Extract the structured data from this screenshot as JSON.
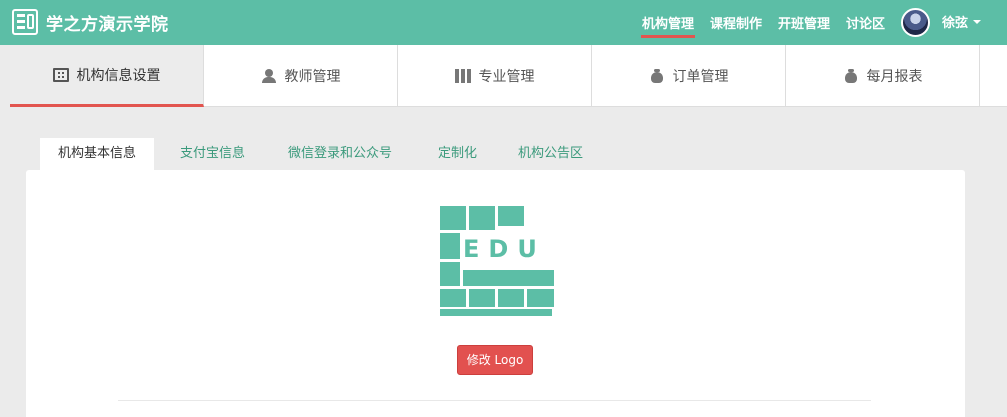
{
  "brand": {
    "title": "学之方演示学院",
    "logo_text": "EDU"
  },
  "topnav": {
    "links": [
      {
        "label": "机构管理",
        "active": true
      },
      {
        "label": "课程制作",
        "active": false
      },
      {
        "label": "开班管理",
        "active": false
      },
      {
        "label": "讨论区",
        "active": false
      }
    ],
    "user_name": "徐弦"
  },
  "subnav": {
    "tabs": [
      {
        "label": "机构信息设置",
        "icon": "building-icon",
        "active": true
      },
      {
        "label": "教师管理",
        "icon": "user-icon",
        "active": false
      },
      {
        "label": "专业管理",
        "icon": "book-icon",
        "active": false
      },
      {
        "label": "订单管理",
        "icon": "money-bag-icon",
        "active": false
      },
      {
        "label": "每月报表",
        "icon": "money-bag-icon",
        "active": false
      }
    ]
  },
  "content_tabs": [
    {
      "label": "机构基本信息",
      "active": true
    },
    {
      "label": "支付宝信息",
      "active": false
    },
    {
      "label": "微信登录和公众号",
      "active": false
    },
    {
      "label": "定制化",
      "active": false
    },
    {
      "label": "机构公告区",
      "active": false
    }
  ],
  "panel": {
    "logo_text": "EDU",
    "edit_logo_label": "修改 Logo"
  },
  "colors": {
    "brand": "#5cbea6",
    "accent": "#e2554f",
    "link": "#3b9a7c"
  }
}
